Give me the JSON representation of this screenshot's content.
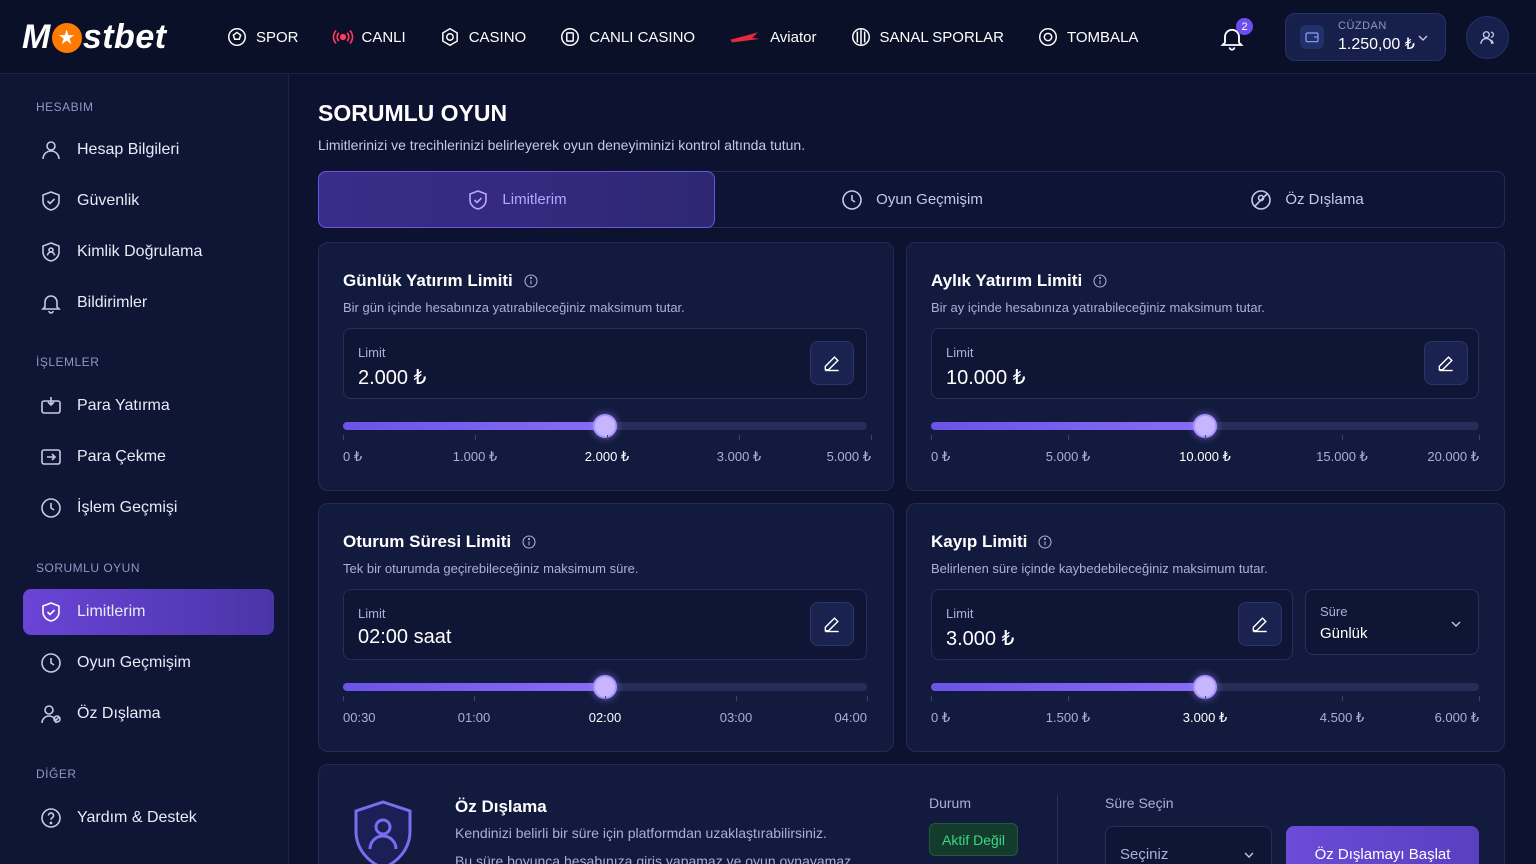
{
  "brand": {
    "logo_left": "M",
    "logo_right": "stbet"
  },
  "nav": [
    {
      "label": "SPOR",
      "icon": "soccer-ball-icon"
    },
    {
      "label": "CANLI",
      "icon": "live-broadcast-icon"
    },
    {
      "label": "CASINO",
      "icon": "casino-chip-icon"
    },
    {
      "label": "CANLI CASINO",
      "icon": "live-casino-icon"
    },
    {
      "label": "Aviator",
      "icon": "aviator-plane-icon"
    },
    {
      "label": "SANAL SPORLAR",
      "icon": "virtual-sports-icon"
    },
    {
      "label": "TOMBALA",
      "icon": "lottery-ball-icon"
    }
  ],
  "notifications": {
    "count": "2"
  },
  "wallet": {
    "label": "CÜZDAN",
    "balance": "1.250,00 ₺"
  },
  "sidebar": {
    "groups": [
      "HESABIM",
      "İŞLEMLER",
      "SORUMLU OYUN",
      "DİĞER"
    ],
    "items": [
      {
        "label": "Hesap Bilgileri",
        "icon": "user-icon"
      },
      {
        "label": "Güvenlik",
        "icon": "shield-check-icon"
      },
      {
        "label": "Kimlik Doğrulama",
        "icon": "shield-id-icon"
      },
      {
        "label": "Bildirimler",
        "icon": "bell-icon"
      },
      {
        "label": "Para Yatırma",
        "icon": "deposit-icon"
      },
      {
        "label": "Para Çekme",
        "icon": "withdraw-icon"
      },
      {
        "label": "İşlem Geçmişi",
        "icon": "history-icon"
      },
      {
        "label": "Limitlerim",
        "icon": "shield-check-icon"
      },
      {
        "label": "Oyun Geçmişim",
        "icon": "clock-icon"
      },
      {
        "label": "Öz Dışlama",
        "icon": "user-block-icon"
      },
      {
        "label": "Yardım & Destek",
        "icon": "help-icon"
      }
    ]
  },
  "page": {
    "title": "SORUMLU OYUN",
    "subtitle": "Limitlerinizi ve trecihlerinizi belirleyerek oyun deneyiminizi kontrol altında tutun."
  },
  "tabs": [
    {
      "label": "Limitlerim",
      "icon": "shield-check-icon"
    },
    {
      "label": "Oyun Geçmişim",
      "icon": "clock-icon"
    },
    {
      "label": "Öz Dışlama",
      "icon": "block-icon"
    }
  ],
  "cards": {
    "daily": {
      "title": "Günlük Yatırım Limiti",
      "desc": "Bir gün içinde hesabınıza yatırabileceğiniz maksimum tutar.",
      "limit_label": "Limit",
      "limit_value": "2.000 ₺",
      "slider_fraction": 0.5,
      "ticks": [
        "0 ₺",
        "1.000 ₺",
        "2.000 ₺",
        "3.000 ₺",
        "5.000 ₺"
      ]
    },
    "monthly": {
      "title": "Aylık Yatırım Limiti",
      "desc": "Bir ay içinde hesabınıza yatırabileceğiniz maksimum tutar.",
      "limit_label": "Limit",
      "limit_value": "10.000 ₺",
      "slider_fraction": 0.5,
      "ticks": [
        "0 ₺",
        "5.000 ₺",
        "10.000 ₺",
        "15.000 ₺",
        "20.000 ₺"
      ]
    },
    "session": {
      "title": "Oturum Süresi Limiti",
      "desc": "Tek bir oturumda geçirebileceğiniz maksimum süre.",
      "limit_label": "Limit",
      "limit_value": "02:00 saat",
      "slider_fraction": 0.5,
      "ticks": [
        "00:30",
        "01:00",
        "02:00",
        "03:00",
        "04:00"
      ]
    },
    "loss": {
      "title": "Kayıp Limiti",
      "desc": "Belirlenen süre içinde kaybedebileceğiniz maksimum tutar.",
      "limit_label": "Limit",
      "limit_value": "3.000 ₺",
      "duration_label": "Süre",
      "duration_value": "Günlük",
      "slider_fraction": 0.5,
      "ticks": [
        "0 ₺",
        "1.500 ₺",
        "3.000 ₺",
        "4.500 ₺",
        "6.000 ₺"
      ]
    }
  },
  "exclusion": {
    "title": "Öz Dışlama",
    "desc1": "Kendinizi belirli bir süre için platformdan uzaklaştırabilirsiniz.",
    "desc2": "Bu süre boyunca hesabınıza giriş yapamaz ve oyun oynayamaz.",
    "status_label": "Durum",
    "status_value": "Aktif Değil",
    "period_label": "Süre Seçin",
    "period_placeholder": "Seçiniz",
    "button": "Öz Dışlamayı Başlat"
  },
  "colors": {
    "accent": "#6b53e8",
    "status_ok": "#39d98a",
    "logo_star": "#ff7a00"
  }
}
